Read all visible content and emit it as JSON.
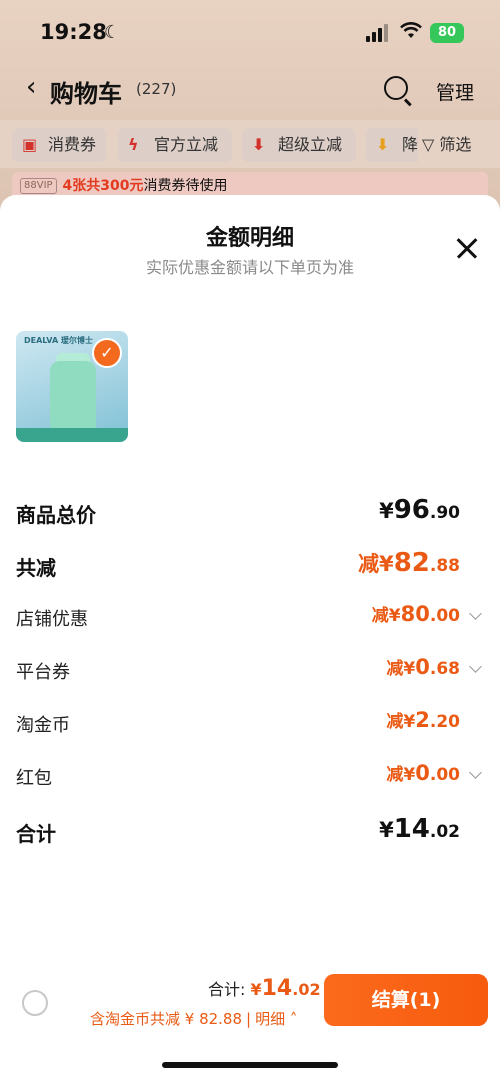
{
  "status_bar": {
    "time": "19:28",
    "battery": "80"
  },
  "nav": {
    "title": "购物车",
    "count": "(227)",
    "manage": "管理"
  },
  "filters": [
    {
      "icon": "coupon-icon",
      "label": "消费券"
    },
    {
      "icon": "lightning-icon",
      "label": "官方立减"
    },
    {
      "icon": "arrow-down-icon",
      "label": "超级立减"
    },
    {
      "icon": "arrow-down-icon",
      "label": "降"
    }
  ],
  "filter_button": "筛选",
  "vip_bar": {
    "badge": "88VIP",
    "highlight": "4张共300元",
    "text": "消费券待使用"
  },
  "sheet": {
    "title": "金额明细",
    "subtitle": "实际优惠金额请以下单页为准",
    "product": {
      "brand": "DEALVA 瑷尔博士"
    }
  },
  "rows": {
    "total_price": {
      "label": "商品总价",
      "currency": "¥",
      "int": "96",
      "dec": ".90"
    },
    "total_discount": {
      "label": "共减",
      "prefix": "减¥",
      "int": "82",
      "dec": ".88"
    },
    "shop_discount": {
      "label": "店铺优惠",
      "prefix": "减¥",
      "int": "80",
      "dec": ".00"
    },
    "platform_coupon": {
      "label": "平台券",
      "prefix": "减¥",
      "int": "0",
      "dec": ".68"
    },
    "taobao_coin": {
      "label": "淘金币",
      "prefix": "减¥",
      "int": "2",
      "dec": ".20"
    },
    "red_packet": {
      "label": "红包",
      "prefix": "减¥",
      "int": "0",
      "dec": ".00"
    },
    "sum": {
      "label": "合计",
      "currency": "¥",
      "int": "14",
      "dec": ".02"
    }
  },
  "bottom": {
    "total_label": "合计: ",
    "total_currency": "¥",
    "total_int": "14",
    "total_dec": ".02",
    "coin_text": "含淘金币共减 ¥ 82.88",
    "detail": "明细",
    "checkout": "结算(1)"
  },
  "colors": {
    "accent": "#ea5a14",
    "button": "#f75b0d",
    "battery": "#35c759"
  }
}
